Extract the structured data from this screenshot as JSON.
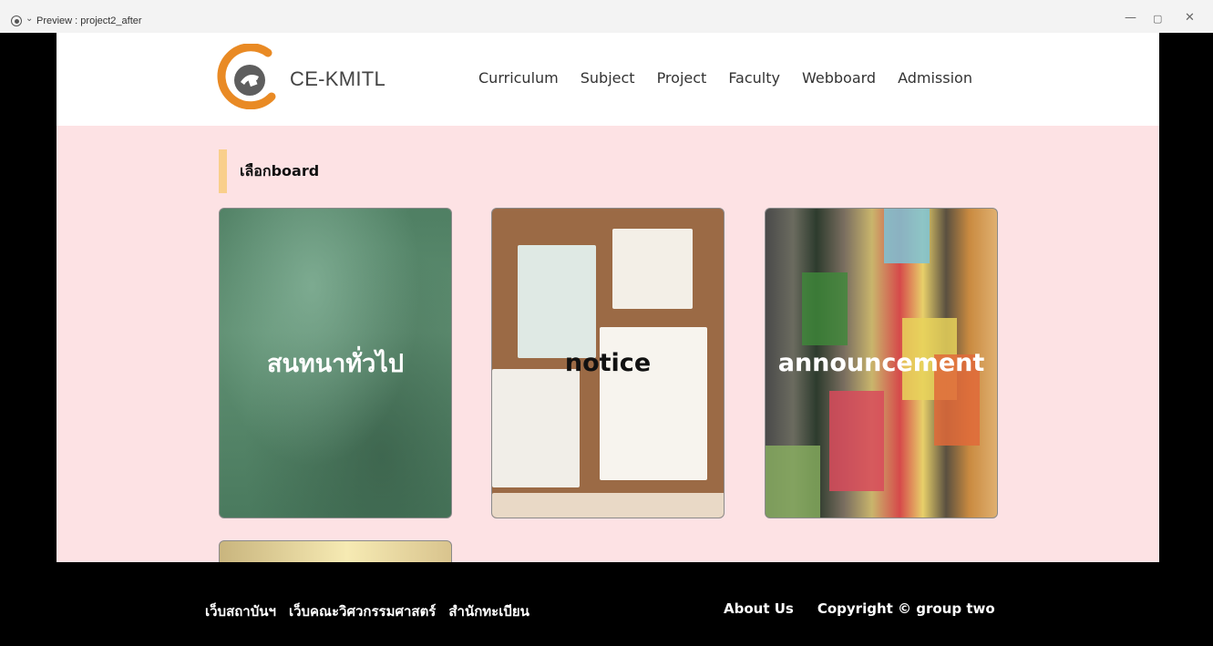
{
  "window": {
    "title": "Preview : project2_after",
    "record_icon": "record-icon",
    "chevron_icon": "chevron-down-icon",
    "minimize_icon": "minimize-icon",
    "maximize_icon": "maximize-icon",
    "close_icon": "close-icon",
    "minimize_glyph": "—",
    "maximize_glyph": "▢",
    "close_glyph": "✕"
  },
  "header": {
    "brand": "CE-KMITL",
    "logo_colors": {
      "orange": "#e98a24",
      "gray": "#606060"
    },
    "nav": [
      "Curriculum",
      "Subject",
      "Project",
      "Faculty",
      "Webboard",
      "Admission"
    ]
  },
  "section": {
    "title": "เลือกboard",
    "accent_color": "#f9cf8b"
  },
  "boards": [
    {
      "label": "สนทนาทั่วไป"
    },
    {
      "label": "notice"
    },
    {
      "label": "announcement"
    }
  ],
  "footer": {
    "links": [
      "เว็บสถาบันฯ",
      "เว็บคณะวิศวกรรมศาสตร์",
      "สำนักทะเบียน"
    ],
    "about": "About Us",
    "copyright": "Copyright © group two"
  },
  "colors": {
    "page_bg": "#fde2e4",
    "footer_bg": "#000000",
    "header_bg": "#ffffff"
  }
}
